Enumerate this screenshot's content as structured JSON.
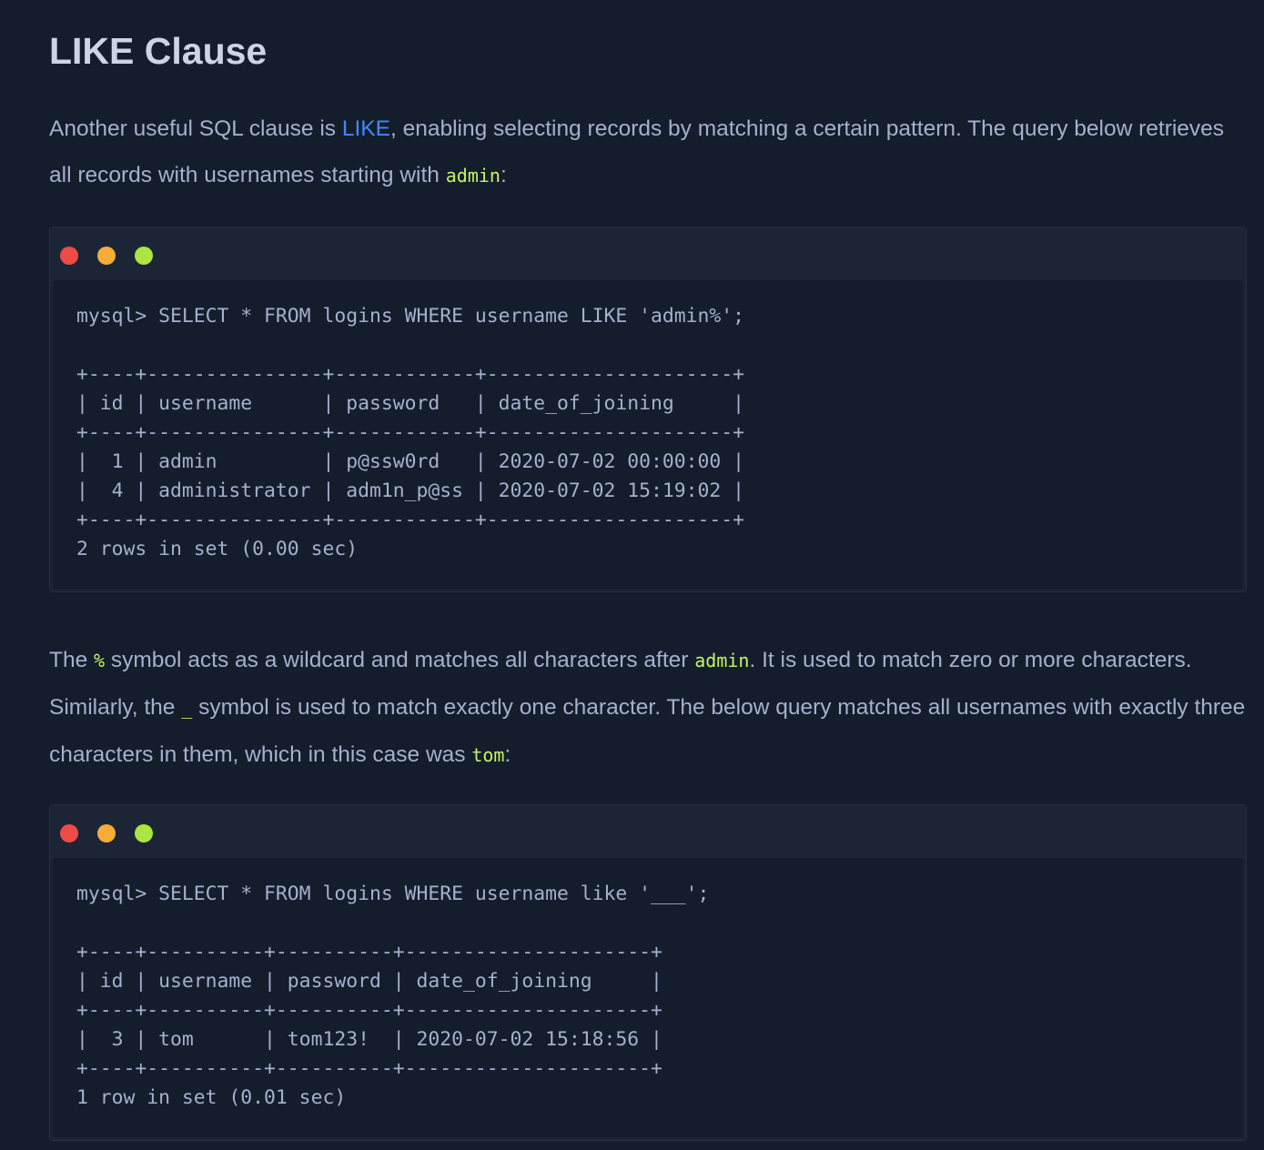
{
  "heading": "LIKE Clause",
  "para1": {
    "t1": "Another useful SQL clause is ",
    "link": "LIKE",
    "t2": ", enabling selecting records by matching a certain pattern. The query below retrieves all records with usernames starting with ",
    "code1": "admin",
    "t3": ":"
  },
  "terminal1": {
    "lines": [
      "mysql> SELECT * FROM logins WHERE username LIKE 'admin%';",
      "",
      "+----+---------------+------------+---------------------+",
      "| id | username      | password   | date_of_joining     |",
      "+----+---------------+------------+---------------------+",
      "|  1 | admin         | p@ssw0rd   | 2020-07-02 00:00:00 |",
      "|  4 | administrator | adm1n_p@ss | 2020-07-02 15:19:02 |",
      "+----+---------------+------------+---------------------+",
      "2 rows in set (0.00 sec)"
    ]
  },
  "para2": {
    "t1": "The ",
    "code1": "%",
    "t2": " symbol acts as a wildcard and matches all characters after ",
    "code2": "admin",
    "t3": ". It is used to match zero or more characters. Similarly, the ",
    "code3": "_",
    "t4": " symbol is used to match exactly one character. The below query matches all usernames with exactly three characters in them, which in this case was ",
    "code4": "tom",
    "t5": ":"
  },
  "terminal2": {
    "lines": [
      "mysql> SELECT * FROM logins WHERE username like '___';",
      "",
      "+----+----------+----------+---------------------+",
      "| id | username | password | date_of_joining     |",
      "+----+----------+----------+---------------------+",
      "|  3 | tom      | tom123!  | 2020-07-02 15:18:56 |",
      "+----+----------+----------+---------------------+",
      "1 row in set (0.01 sec)"
    ]
  },
  "colors": {
    "background": "#141d2b",
    "text": "#a4b1cd",
    "heading": "#cdd5e4",
    "link": "#3e8bf5",
    "code": "#c5f467",
    "dot_red": "#ef4b46",
    "dot_yellow": "#f4ad37",
    "dot_green": "#a9e63f"
  }
}
